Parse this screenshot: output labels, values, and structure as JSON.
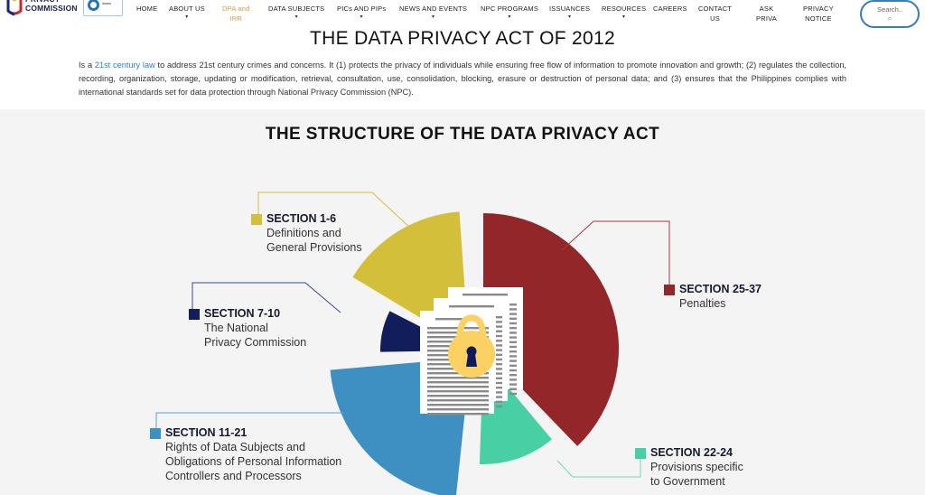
{
  "header": {
    "logo_text_line1": "PRIVACY",
    "logo_text_line2": "COMMISSION",
    "nav": [
      {
        "label": "HOME",
        "has_dropdown": false
      },
      {
        "label": "ABOUT US",
        "has_dropdown": true
      },
      {
        "label_line1": "DPA and",
        "label_line2": "IRR",
        "active": true
      },
      {
        "label": "DATA SUBJECTS",
        "has_dropdown": true
      },
      {
        "label": "PICs AND PIPs",
        "has_dropdown": true
      },
      {
        "label": "NEWS AND EVENTS",
        "has_dropdown": true
      },
      {
        "label": "NPC PROGRAMS",
        "has_dropdown": true
      },
      {
        "label": "ISSUANCES",
        "has_dropdown": true
      },
      {
        "label": "RESOURCES",
        "has_dropdown": true
      },
      {
        "label": "CAREERS",
        "has_dropdown": false
      },
      {
        "label_line1": "CONTACT",
        "label_line2": "US"
      },
      {
        "label_line1": "ASK",
        "label_line2": "PRIVA"
      },
      {
        "label_line1": "PRIVACY",
        "label_line2": "NOTICE"
      }
    ],
    "search_placeholder": "Search..",
    "search_icon": "magnifier-icon",
    "caret_glyph": "▾",
    "search_glyph": "⌕"
  },
  "page": {
    "title": "THE DATA PRIVACY ACT OF 2012",
    "intro_prefix": "Is a ",
    "intro_link": "21st century law",
    "intro_rest": " to address 21st century crimes and concerns. It (1) protects the privacy of individuals while ensuring free flow of information to promote innovation and growth; (2) regulates the collection, recording, organization, storage, updating or modification, retrieval, consultation, use, consolidation, blocking, erasure or destruction of personal data; and (3) ensures that the Philippines complies with international standards set for data protection through National Privacy Commission (NPC).",
    "subtitle": "THE STRUCTURE OF THE DATA PRIVACY ACT"
  },
  "colors": {
    "accent_link": "#2a7fd4",
    "active_nav": "#d49a3a",
    "yellow": "#d4bf3a",
    "red": "#922629",
    "green": "#48d0a4",
    "blue": "#3e8fc2",
    "navy": "#121d5c",
    "lock": "#fcd164"
  },
  "chart_data": {
    "type": "pie",
    "title": "THE STRUCTURE OF THE DATA PRIVACY ACT",
    "center_icon": "document-lock-icon",
    "slices": [
      {
        "key": "red",
        "heading": "SECTION 25-37",
        "description": [
          "Penalties"
        ],
        "sections": 13,
        "start_deg": 0,
        "end_deg": 136
      },
      {
        "key": "green",
        "heading": "SECTION 22-24",
        "description": [
          "Provisions specific",
          "to Government"
        ],
        "sections": 3,
        "start_deg": 140,
        "end_deg": 182
      },
      {
        "key": "blue",
        "heading": "SECTION 11-21",
        "description": [
          "Rights of Data Subjects and",
          "Obligations of Personal Information",
          "Controllers and Processors"
        ],
        "sections": 11,
        "start_deg": 186,
        "end_deg": 265
      },
      {
        "key": "navy",
        "heading": "SECTION 7-10",
        "description": [
          "The National",
          "Privacy Commission"
        ],
        "sections": 4,
        "start_deg": 269,
        "end_deg": 297
      },
      {
        "key": "yellow",
        "heading": "SECTION 1-6",
        "description": [
          "Definitions and",
          "General Provisions"
        ],
        "sections": 6,
        "start_deg": 301,
        "end_deg": 356
      }
    ]
  }
}
